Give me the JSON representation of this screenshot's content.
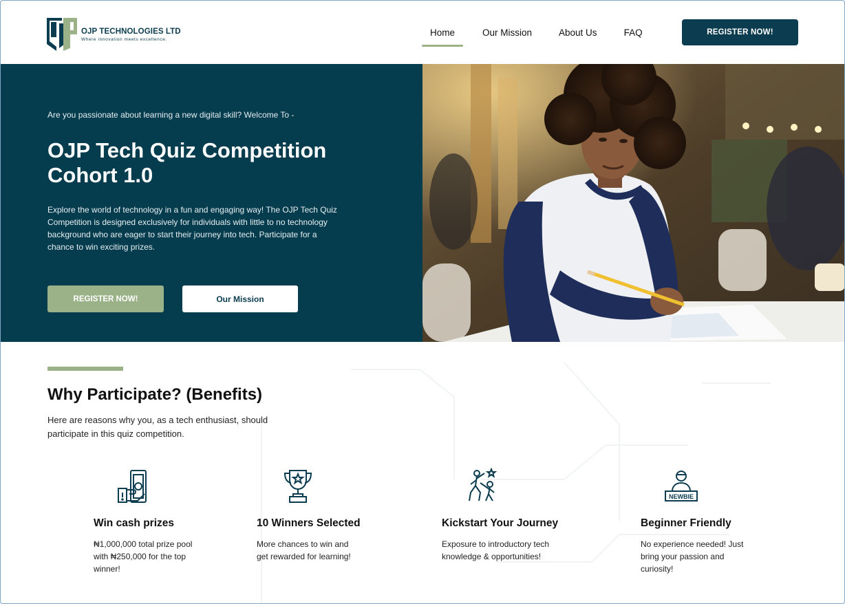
{
  "brand": {
    "name": "OJP TECHNOLOGIES LTD",
    "tagline": "Where innovation meets excellence.",
    "colors": {
      "primary": "#0c3c4f",
      "hero_bg": "#053d4f",
      "accent": "#9bb288"
    }
  },
  "nav": {
    "items": [
      {
        "label": "Home",
        "active": true
      },
      {
        "label": "Our Mission"
      },
      {
        "label": "About Us"
      },
      {
        "label": "FAQ"
      }
    ],
    "cta_label": "REGISTER NOW!"
  },
  "hero": {
    "eyebrow": "Are you passionate about learning a new digital skill? Welcome To -",
    "title_line1": "OJP Tech Quiz Competition",
    "title_line2": "Cohort 1.0",
    "description": "Explore the world of technology in a fun and engaging way! The OJP Tech Quiz Competition is designed exclusively for individuals with little to no technology background who are eager to start their journey into tech. Participate for a chance to win exciting prizes.",
    "primary_button": "REGISTER NOW!",
    "secondary_button": "Our Mission"
  },
  "benefits": {
    "title": "Why Participate? (Benefits)",
    "subtitle": "Here are reasons why you, as a tech enthusiast, should participate in this quiz competition.",
    "items": [
      {
        "icon": "cash-prize-icon",
        "title": "Win cash prizes",
        "desc": "₦1,000,000 total prize pool with ₦250,000 for the top winner!"
      },
      {
        "icon": "trophy-icon",
        "title": "10 Winners Selected",
        "desc": "More chances to win and get rewarded for learning!"
      },
      {
        "icon": "climbing-people-icon",
        "title": "Kickstart Your Journey",
        "desc": "Exposure to introductory tech knowledge & opportunities!"
      },
      {
        "icon": "newbie-icon",
        "title": "Beginner Friendly",
        "desc": "No experience needed! Just bring your passion and curiosity!"
      }
    ]
  }
}
